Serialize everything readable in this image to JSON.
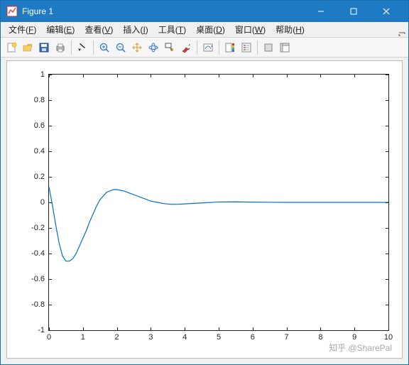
{
  "titlebar": {
    "title": "Figure 1"
  },
  "menu": {
    "file": {
      "label": "文件",
      "key": "F"
    },
    "edit": {
      "label": "编辑",
      "key": "E"
    },
    "view": {
      "label": "查看",
      "key": "V"
    },
    "insert": {
      "label": "插入",
      "key": "I"
    },
    "tools": {
      "label": "工具",
      "key": "T"
    },
    "desktop": {
      "label": "桌面",
      "key": "D"
    },
    "window": {
      "label": "窗口",
      "key": "W"
    },
    "help": {
      "label": "帮助",
      "key": "H"
    }
  },
  "toolbar_icons": {
    "new": "new-figure-icon",
    "open": "open-icon",
    "save": "save-icon",
    "print": "print-icon",
    "pointer": "pointer-icon",
    "zoom_in": "zoom-in-icon",
    "zoom_out": "zoom-out-icon",
    "pan": "pan-icon",
    "rotate3d": "rotate3d-icon",
    "datacursor": "data-cursor-icon",
    "brush": "brush-icon",
    "link": "link-icon",
    "colorbar": "colorbar-icon",
    "legend": "legend-icon",
    "hide_tools": "hide-plot-tools-icon",
    "show_tools": "show-plot-tools-icon"
  },
  "colors": {
    "line": "#0072bd",
    "axis": "#222222",
    "titlebar": "#1e7ac2"
  },
  "chart_data": {
    "type": "line",
    "title": "",
    "xlabel": "",
    "ylabel": "",
    "xlim": [
      0,
      10
    ],
    "ylim": [
      -1,
      1
    ],
    "xticks": [
      0,
      1,
      2,
      3,
      4,
      5,
      6,
      7,
      8,
      9,
      10
    ],
    "yticks": [
      -1,
      -0.8,
      -0.6,
      -0.4,
      -0.2,
      0,
      0.2,
      0.4,
      0.6,
      0.8,
      1
    ],
    "grid": false,
    "x": [
      0,
      0.1,
      0.2,
      0.3,
      0.4,
      0.5,
      0.6,
      0.7,
      0.8,
      0.9,
      1.0,
      1.1,
      1.2,
      1.3,
      1.4,
      1.5,
      1.6,
      1.7,
      1.8,
      1.9,
      2.0,
      2.2,
      2.4,
      2.6,
      2.8,
      3.0,
      3.2,
      3.4,
      3.6,
      3.8,
      4.0,
      4.5,
      5.0,
      5.5,
      6.0,
      6.5,
      7.0,
      8.0,
      9.0,
      10.0
    ],
    "y": [
      0.12,
      -0.02,
      -0.18,
      -0.32,
      -0.42,
      -0.46,
      -0.46,
      -0.44,
      -0.4,
      -0.34,
      -0.28,
      -0.22,
      -0.15,
      -0.09,
      -0.03,
      0.02,
      0.05,
      0.08,
      0.09,
      0.1,
      0.1,
      0.09,
      0.07,
      0.05,
      0.03,
      0.01,
      0.0,
      -0.01,
      -0.015,
      -0.015,
      -0.012,
      -0.004,
      0.003,
      0.004,
      0.002,
      0.001,
      0.0,
      0.0,
      0.0,
      0.0
    ]
  },
  "watermark": "知乎 @SharePal"
}
